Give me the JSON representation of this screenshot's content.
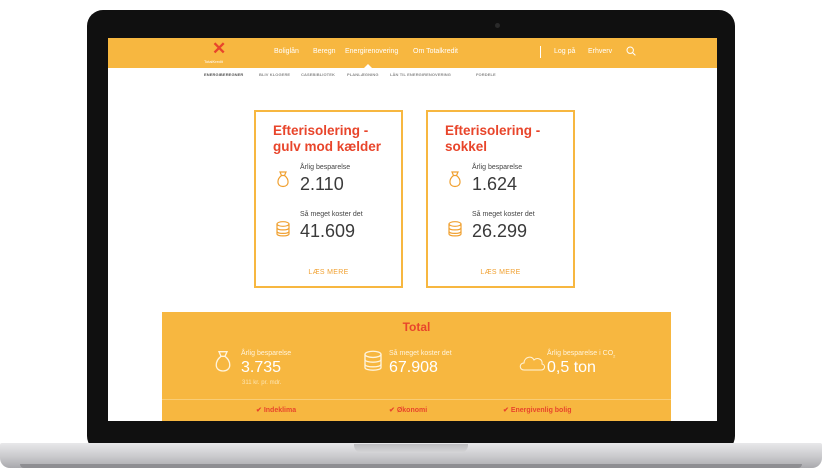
{
  "colors": {
    "accent": "#f7b740",
    "brand_red": "#e8452b",
    "text_dark": "#3a3a3a"
  },
  "logo": {
    "text": "TotalKredit",
    "icon": "x-logo-icon"
  },
  "nav": {
    "items": [
      "Boliglån",
      "Beregn",
      "Energirenovering",
      "Om Totalkredit"
    ],
    "login": "Log på",
    "business": "Erhverv",
    "search_icon": "search-icon"
  },
  "subnav": {
    "items": [
      "ENERGIBEREGNER",
      "BLIV KLOGERE",
      "CASEBIBLIOTEK",
      "PLANLÆGNING",
      "LÅN TIL ENERGIRENOVERING",
      "FORDELE"
    ]
  },
  "cards": [
    {
      "title_line1": "Efterisolering -",
      "title_line2": "gulv mod kælder",
      "savings_label": "Årlig besparelse",
      "savings_value": "2.110",
      "cost_label": "Så meget koster det",
      "cost_value": "41.609",
      "link": "LÆS MERE"
    },
    {
      "title_line1": "Efterisolering -",
      "title_line2": "sokkel",
      "savings_label": "Årlig besparelse",
      "savings_value": "1.624",
      "cost_label": "Så meget koster det",
      "cost_value": "26.299",
      "link": "LÆS MERE"
    }
  ],
  "total": {
    "title": "Total",
    "savings_label": "Årlig besparelse",
    "savings_value": "3.735",
    "savings_sub": "311 kr. pr. mdr.",
    "cost_label": "Så meget koster det",
    "cost_value": "67.908",
    "co2_label": "Årlig besparelse i CO",
    "co2_sub": "2",
    "co2_value": "0,5 ton",
    "benefits": [
      "Indeklima",
      "Økonomi",
      "Energivenlig bolig"
    ]
  }
}
